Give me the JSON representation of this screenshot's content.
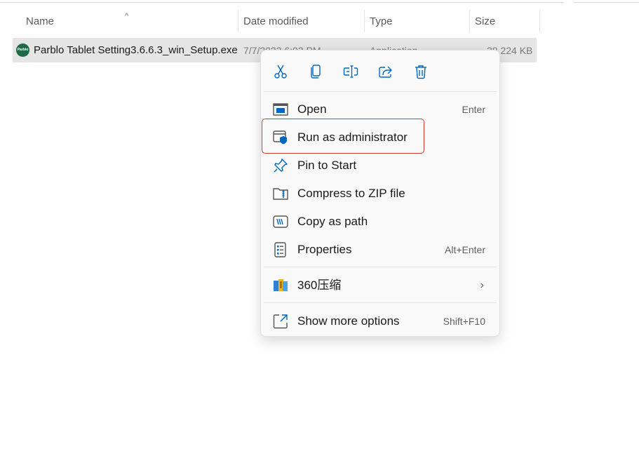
{
  "columns": {
    "name": "Name",
    "date_modified": "Date modified",
    "type": "Type",
    "size": "Size"
  },
  "sort_indicator": "^",
  "file": {
    "icon_text": "Parblo",
    "name": "Parblo Tablet Setting3.6.6.3_win_Setup.exe",
    "date": "7/7/2023 6:03 PM",
    "type": "Application",
    "size": "38,224 KB"
  },
  "context_menu": {
    "quick_actions": [
      {
        "name": "cut",
        "icon": "scissors-icon"
      },
      {
        "name": "copy",
        "icon": "copy-icon"
      },
      {
        "name": "rename",
        "icon": "rename-icon"
      },
      {
        "name": "share",
        "icon": "share-icon"
      },
      {
        "name": "delete",
        "icon": "trash-icon"
      }
    ],
    "items": [
      {
        "label": "Open",
        "accel": "Enter",
        "icon": "open-window-icon"
      },
      {
        "label": "Run as administrator",
        "accel": "",
        "icon": "admin-shield-icon"
      },
      {
        "label": "Pin to Start",
        "accel": "",
        "icon": "pin-icon"
      },
      {
        "label": "Compress to ZIP file",
        "accel": "",
        "icon": "zip-folder-icon"
      },
      {
        "label": "Copy as path",
        "accel": "",
        "icon": "copy-path-icon"
      },
      {
        "label": "Properties",
        "accel": "Alt+Enter",
        "icon": "properties-icon"
      },
      {
        "label": "360压缩",
        "accel": "",
        "icon": "archive-360-icon"
      },
      {
        "label": "Show more options",
        "accel": "Shift+F10",
        "icon": "more-options-icon"
      }
    ]
  },
  "colors": {
    "accent": "#0067c0",
    "highlight_border": "#d33a2c",
    "selected_row": "#e5e5e5"
  }
}
